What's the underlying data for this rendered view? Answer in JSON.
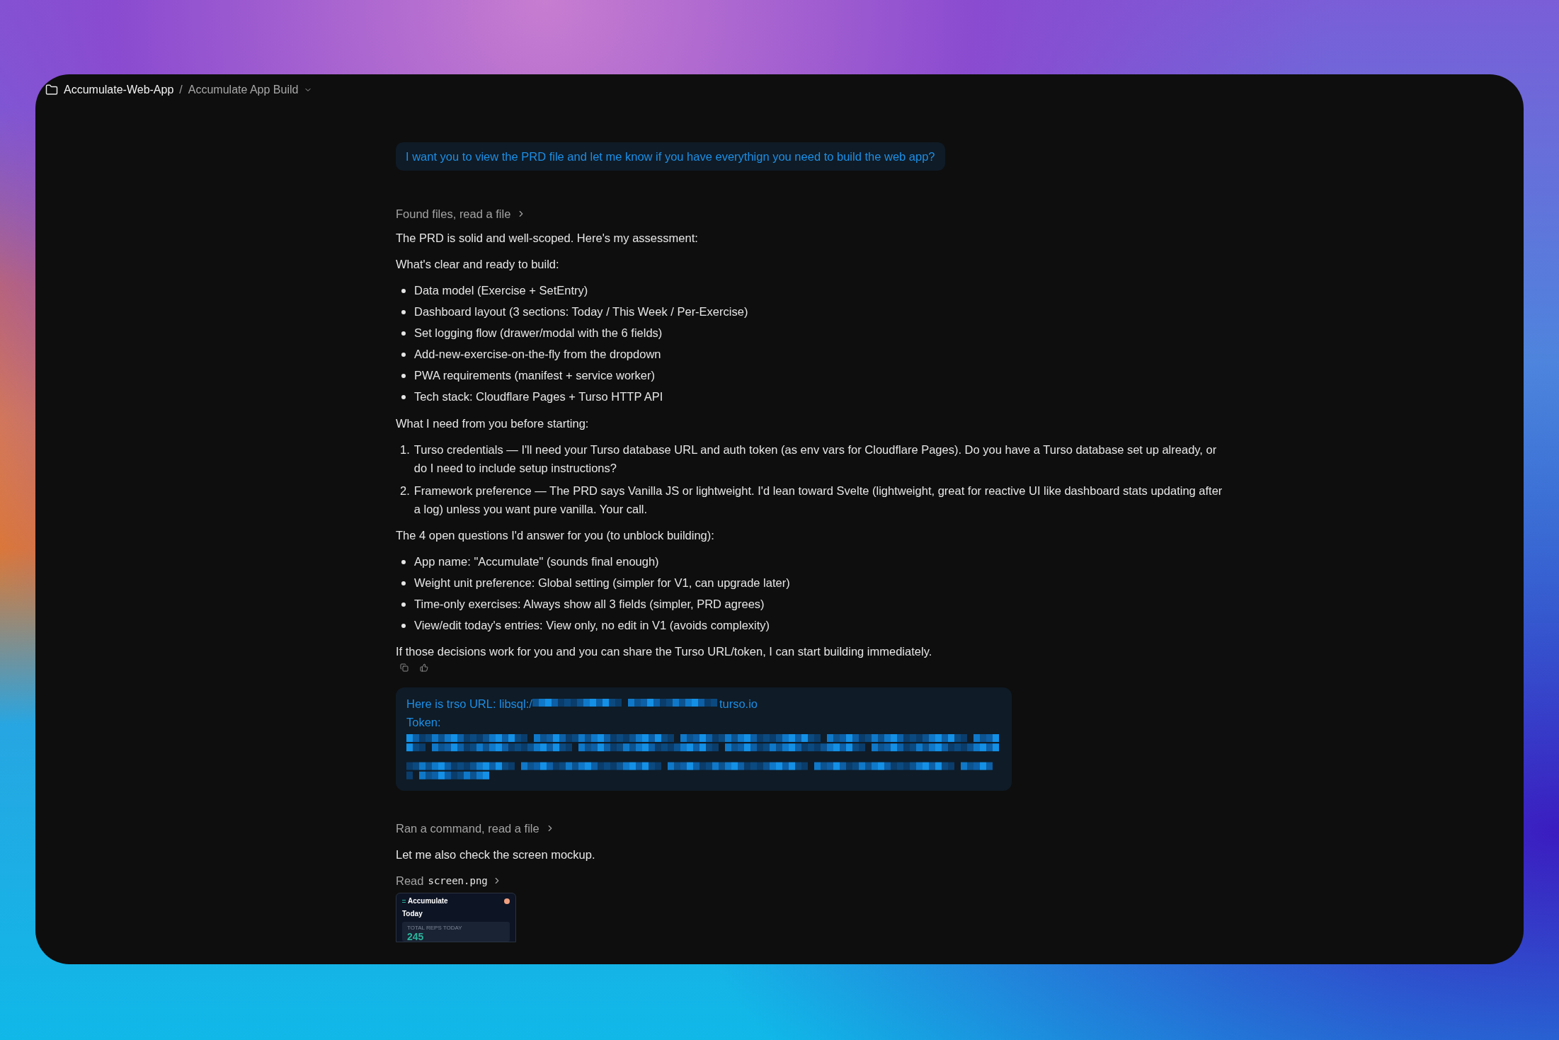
{
  "breadcrumb": {
    "project": "Accumulate-Web-App",
    "separator": "/",
    "chat": "Accumulate App Build"
  },
  "user_message": "I want you to view the PRD file and let me know if you have everythign you need to build the web app?",
  "response_1": {
    "activity": "Found files, read a file",
    "intro": "The PRD is solid and well-scoped. Here's my assessment:",
    "clear_heading": "What's clear and ready to build:",
    "clear_items": [
      "Data model (Exercise + SetEntry)",
      "Dashboard layout (3 sections: Today / This Week / Per-Exercise)",
      "Set logging flow (drawer/modal with the 6 fields)",
      "Add-new-exercise-on-the-fly from the dropdown",
      "PWA requirements (manifest + service worker)",
      "Tech stack: Cloudflare Pages + Turso HTTP API"
    ],
    "need_heading": "What I need from you before starting:",
    "need_items": [
      {
        "number": "1.",
        "text": "Turso credentials — I'll need your Turso database URL and auth token (as env vars for Cloudflare Pages). Do you have a Turso database set up already, or do I need to include setup instructions?"
      },
      {
        "number": "2.",
        "text": "Framework preference — The PRD says Vanilla JS or lightweight. I'd lean toward Svelte (lightweight, great for reactive UI like dashboard stats updating after a log) unless you want pure vanilla. Your call."
      }
    ],
    "open_heading": "The 4 open questions I'd answer for you (to unblock building):",
    "open_items": [
      "App name: \"Accumulate\" (sounds final enough)",
      "Weight unit preference: Global setting (simpler for V1, can upgrade later)",
      "Time-only exercises: Always show all 3 fields (simpler, PRD agrees)",
      "View/edit today's entries: View only, no edit in V1 (avoids complexity)"
    ],
    "closing": "If those decisions work for you and you can share the Turso URL/token, I can start building immediately."
  },
  "user_message_2": {
    "url_label": "Here is trso URL: libsql:/",
    "url_suffix": "turso.io",
    "token_label": "Token:"
  },
  "response_2": {
    "activity": "Ran a command, read a file",
    "text": "Let me also check the screen mockup.",
    "read_label": "Read",
    "file_name": "screen.png",
    "thumbnail": {
      "title": "Accumulate",
      "section": "Today",
      "stat_label": "TOTAL REPS TODAY",
      "stat_value": "245"
    }
  }
}
